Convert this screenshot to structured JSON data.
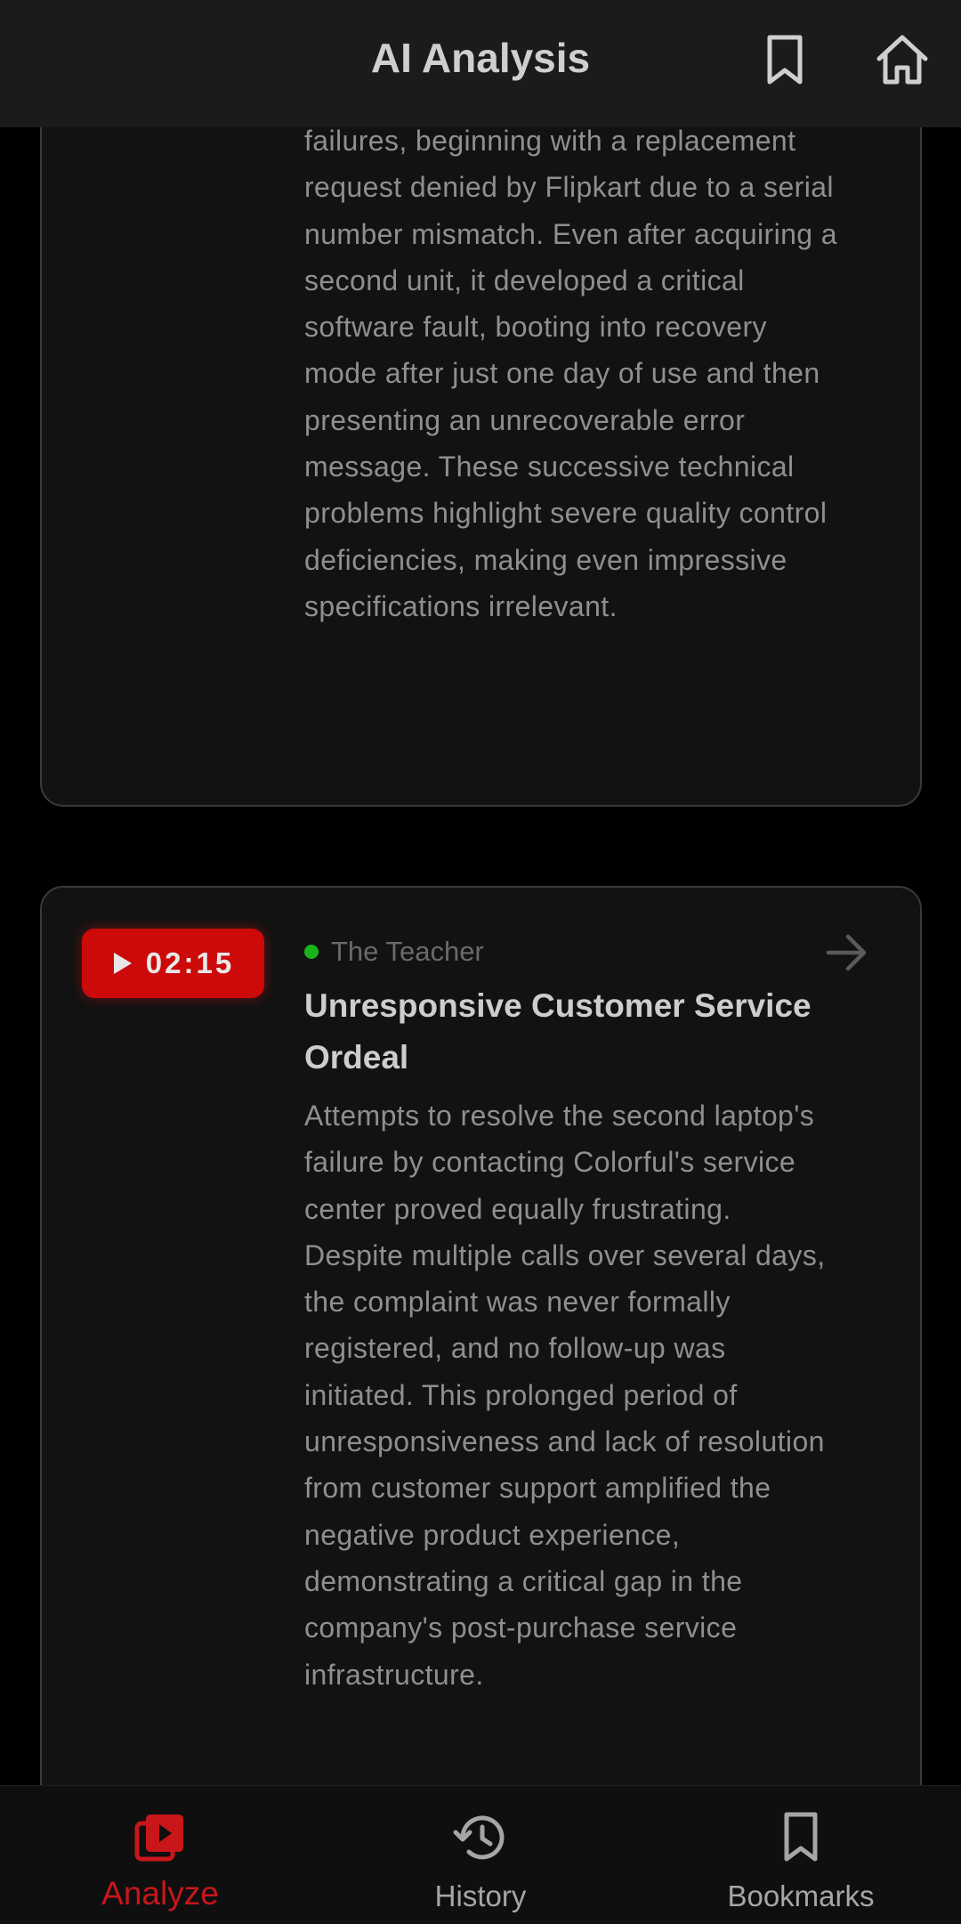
{
  "header": {
    "title": "AI Analysis",
    "bookmark_icon": "bookmark-icon",
    "home_icon": "home-icon"
  },
  "cards": [
    {
      "body": "failures, beginning with a replacement request denied by Flipkart due to a serial number mismatch. Even after acquiring a second unit, it developed a critical software fault, booting into recovery mode after just one day of use and then presenting an unrecoverable error message. These successive technical problems highlight severe quality control deficiencies, making even impressive specifications irrelevant."
    },
    {
      "timestamp": "02:15",
      "persona": "The Teacher",
      "persona_status_color": "#18b418",
      "title": "Unresponsive Customer Service Ordeal",
      "body": "Attempts to resolve the second laptop's failure by contacting Colorful's service center proved equally frustrating. Despite multiple calls over several days, the complaint was never formally registered, and no follow-up was initiated. This prolonged period of unresponsiveness and lack of resolution from customer support amplified the negative product experience, demonstrating a critical gap in the company's post-purchase service infrastructure."
    }
  ],
  "bottom_nav": {
    "items": [
      {
        "label": "Analyze",
        "icon": "video-library-icon",
        "active": true
      },
      {
        "label": "History",
        "icon": "history-icon",
        "active": false
      },
      {
        "label": "Bookmarks",
        "icon": "bookmark-icon",
        "active": false
      }
    ]
  },
  "colors": {
    "accent": "#cc0a0a",
    "background": "#000000",
    "card": "#121212",
    "header": "#1c1a1a"
  }
}
